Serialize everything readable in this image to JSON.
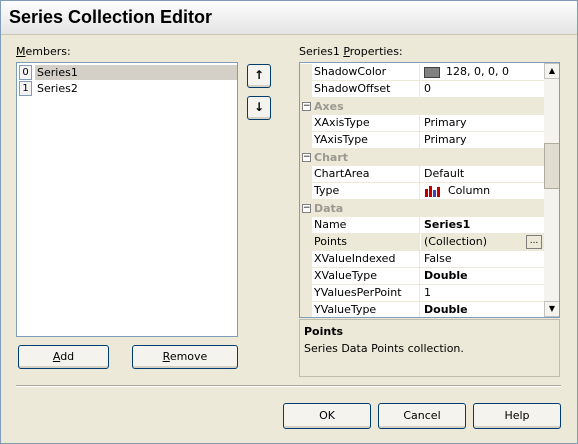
{
  "window": {
    "title": "Series Collection Editor"
  },
  "members": {
    "label": "Members:",
    "items": [
      {
        "index": "0",
        "name": "Series1"
      },
      {
        "index": "1",
        "name": "Series2"
      }
    ],
    "add_label": "Add",
    "remove_label": "Remove"
  },
  "order_buttons": {
    "up": "↑",
    "down": "↓"
  },
  "properties": {
    "label": "Series1 Properties:",
    "rows": [
      {
        "kind": "prop",
        "name": "ShadowColor",
        "value": "128, 0, 0, 0",
        "swatch": "#808080"
      },
      {
        "kind": "prop",
        "name": "ShadowOffset",
        "value": "0"
      },
      {
        "kind": "category",
        "name": "Axes"
      },
      {
        "kind": "prop",
        "name": "XAxisType",
        "value": "Primary"
      },
      {
        "kind": "prop",
        "name": "YAxisType",
        "value": "Primary"
      },
      {
        "kind": "category",
        "name": "Chart"
      },
      {
        "kind": "prop",
        "name": "ChartArea",
        "value": "Default"
      },
      {
        "kind": "prop",
        "name": "Type",
        "value": "Column",
        "icon": "column-chart-icon"
      },
      {
        "kind": "category",
        "name": "Data"
      },
      {
        "kind": "prop",
        "name": "Name",
        "value": "Series1",
        "bold": true
      },
      {
        "kind": "prop",
        "name": "Points",
        "value": "(Collection)",
        "selected": true,
        "ellipsis": "..."
      },
      {
        "kind": "prop",
        "name": "XValueIndexed",
        "value": "False"
      },
      {
        "kind": "prop",
        "name": "XValueType",
        "value": "Double",
        "bold": true
      },
      {
        "kind": "prop",
        "name": "YValuesPerPoint",
        "value": "1"
      },
      {
        "kind": "prop",
        "name": "YValueType",
        "value": "Double",
        "bold": true
      }
    ]
  },
  "description": {
    "title": "Points",
    "text": "Series Data Points collection."
  },
  "dialog_buttons": {
    "ok": "OK",
    "cancel": "Cancel",
    "help": "Help"
  }
}
